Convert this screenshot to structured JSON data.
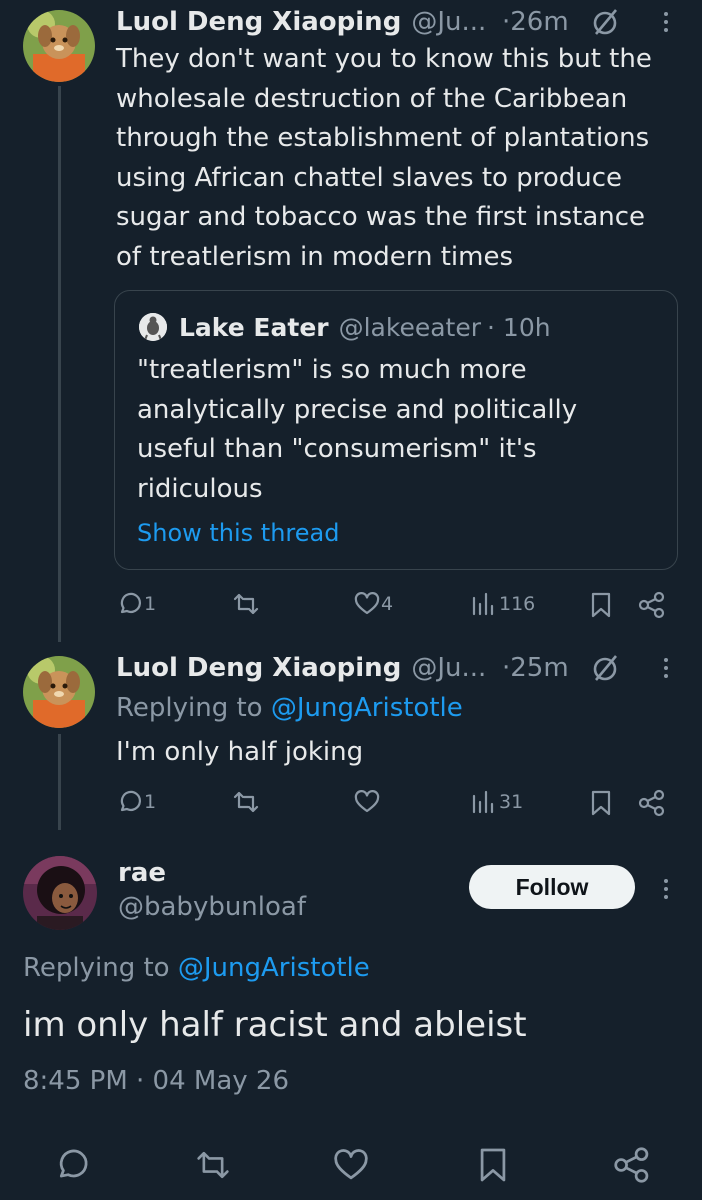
{
  "tweet1": {
    "name": "Luol Deng Xiaoping",
    "handle": "@Ju...",
    "time": "·26m",
    "lines": [
      "They don't want you to know this but the",
      "wholesale destruction of the Caribbean",
      "through the establishment of plantations",
      "using African chattel slaves to produce",
      "sugar and tobacco was the first instance",
      "of treatlerism in modern times"
    ],
    "quote": {
      "name": "Lake Eater",
      "handle": "@lakeeater",
      "time": "· 10h",
      "lines": [
        "\"treatlerism\" is so much more",
        "analytically precise and politically",
        "useful than \"consumerism\" it's",
        "ridiculous"
      ],
      "show_thread": "Show this thread"
    },
    "replies": "1",
    "likes": "4",
    "views": "116"
  },
  "tweet2": {
    "name": "Luol Deng Xiaoping",
    "handle": "@Ju...",
    "time": "·25m",
    "replying_prefix": "Replying to",
    "replying_handle": "@JungAristotle",
    "text": "I'm only half joking",
    "replies": "1",
    "views": "31"
  },
  "tweet3": {
    "name": "rae",
    "handle": "@babybunloaf",
    "follow_label": "Follow",
    "replying_prefix": "Replying to",
    "replying_handle": "@JungAristotle",
    "text": "im only half racist and ableist",
    "timestamp": "8:45 PM · 04 May 26"
  },
  "colors": {
    "background": "#15202b",
    "text": "#e7e9ea",
    "muted": "#8b98a5",
    "accent": "#1d9bf0",
    "border": "#38444d"
  },
  "icons": [
    "reply-icon",
    "retweet-icon",
    "like-icon",
    "views-icon",
    "bookmark-icon",
    "share-icon",
    "hidden-icon",
    "more-icon"
  ]
}
